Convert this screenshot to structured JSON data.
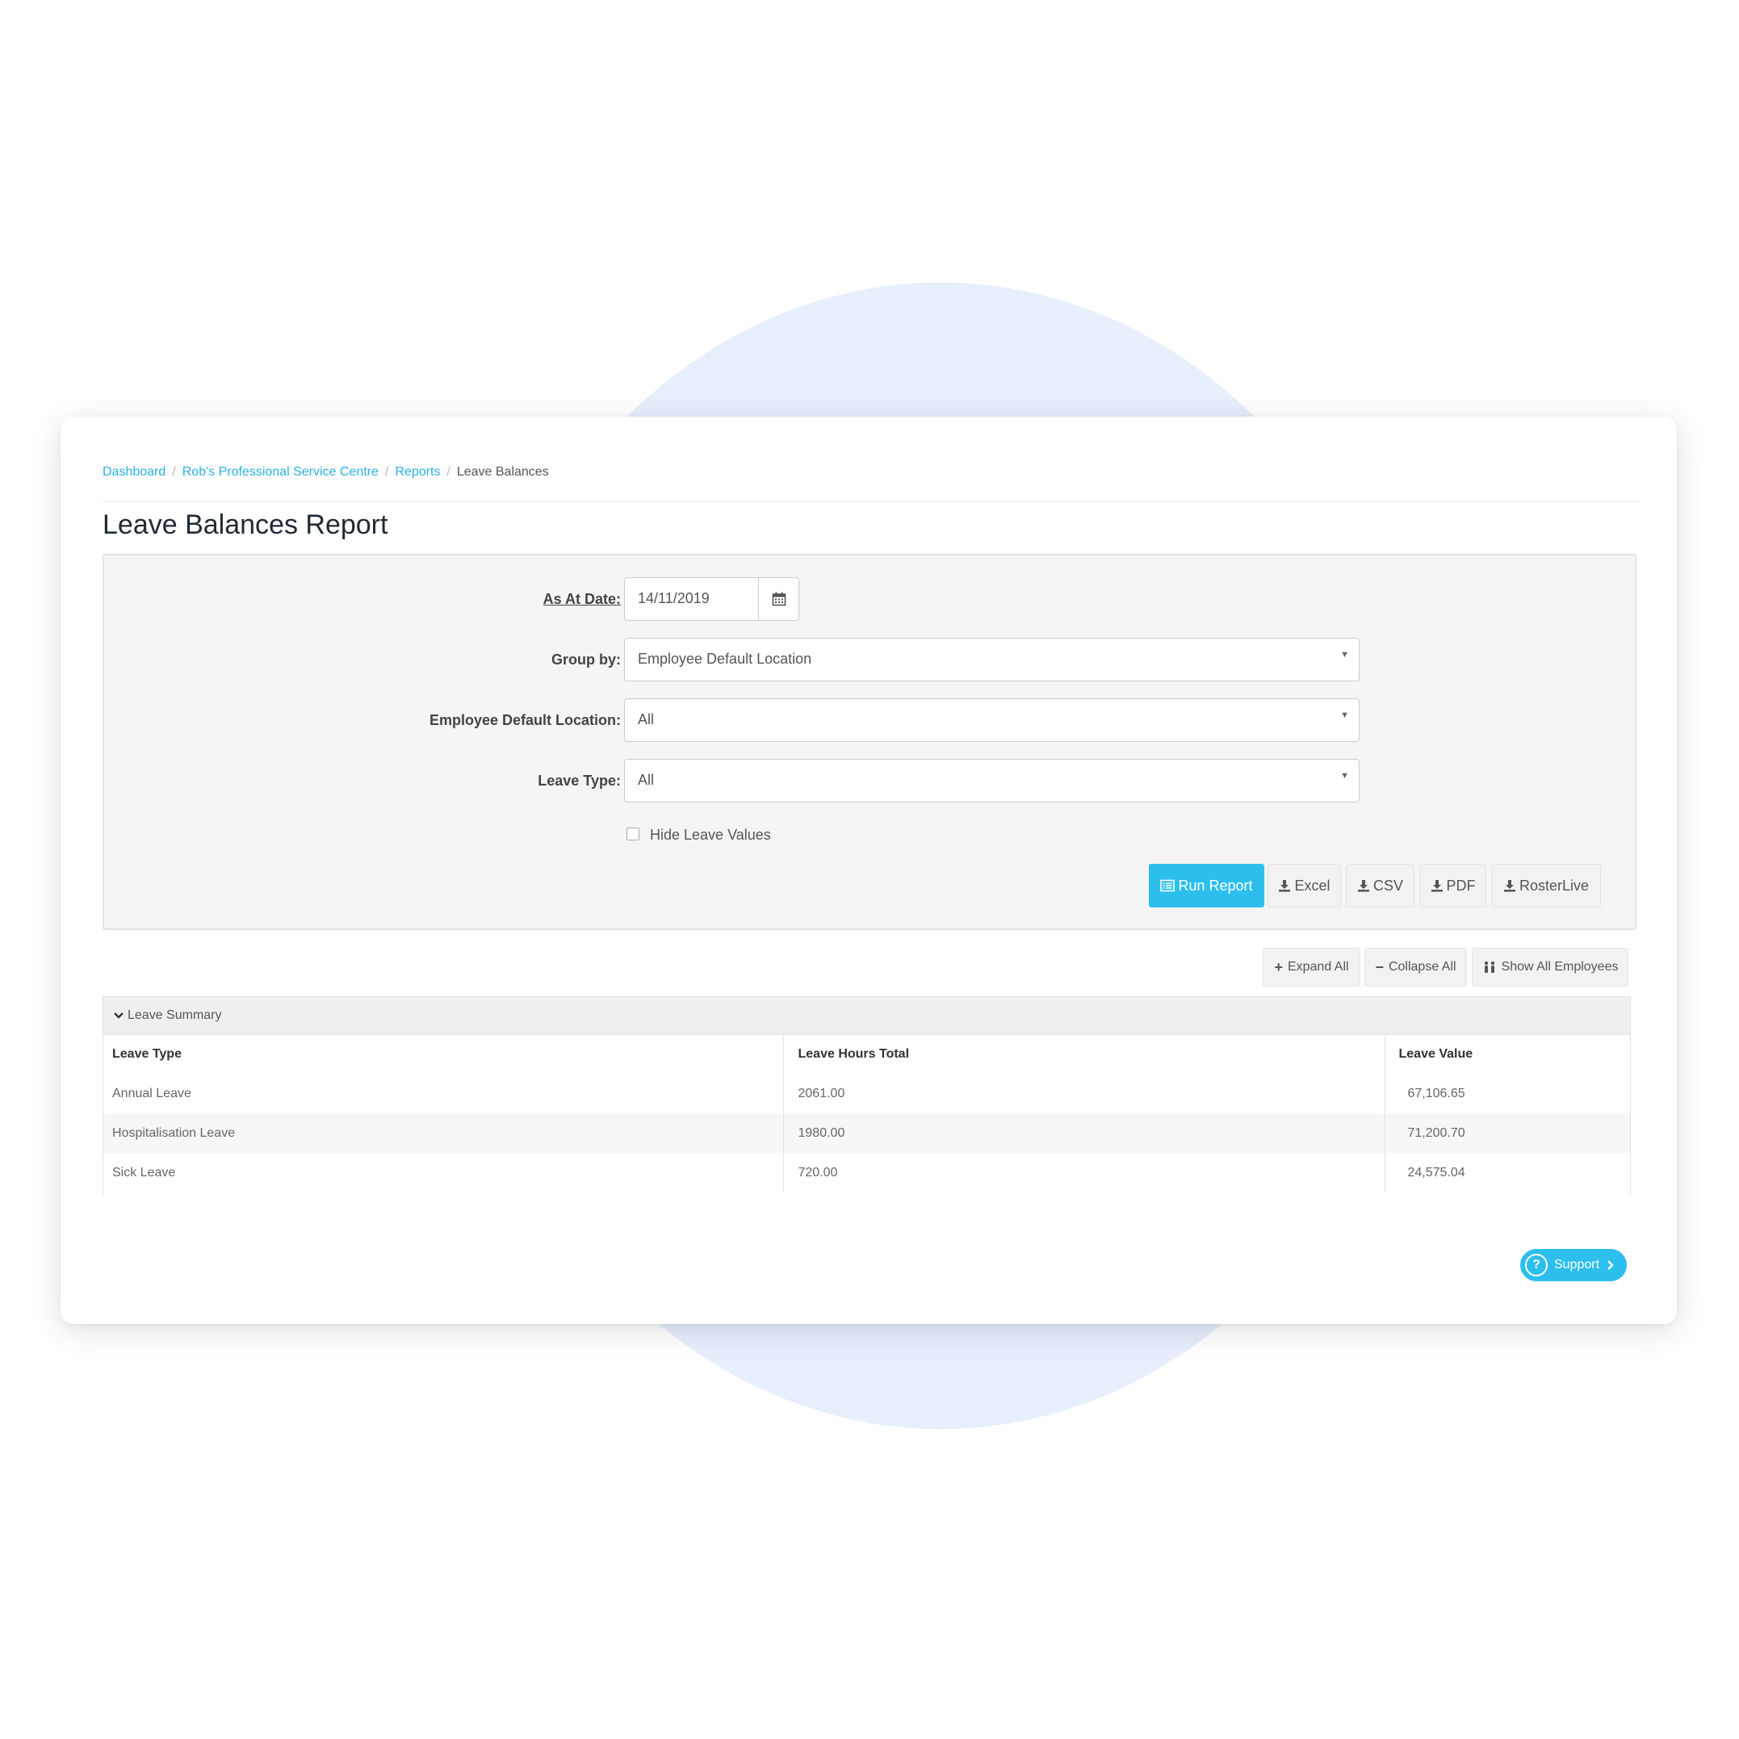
{
  "breadcrumb": {
    "items": [
      "Dashboard",
      "Rob's Professional Service Centre",
      "Reports"
    ],
    "current": "Leave Balances"
  },
  "page": {
    "title": "Leave Balances Report"
  },
  "form": {
    "as_at_date_label": "As At Date:",
    "as_at_date_value": "14/11/2019",
    "group_by_label": "Group by:",
    "group_by_value": "Employee Default Location",
    "location_label": "Employee Default Location:",
    "location_value": "All",
    "leave_type_label": "Leave Type:",
    "leave_type_value": "All",
    "hide_values_label": "Hide Leave Values",
    "hide_values_checked": false
  },
  "actions": {
    "run_report": "Run Report",
    "excel": "Excel",
    "csv": "CSV",
    "pdf": "PDF",
    "rosterlive": "RosterLive"
  },
  "toolbar": {
    "expand_all": "Expand All",
    "collapse_all": "Collapse All",
    "show_all_employees": "Show All Employees"
  },
  "summary": {
    "title": "Leave Summary",
    "columns": [
      "Leave Type",
      "Leave Hours Total",
      "Leave Value"
    ],
    "rows": [
      [
        "Annual Leave",
        "2061.00",
        "67,106.65"
      ],
      [
        "Hospitalisation Leave",
        "1980.00",
        "71,200.70"
      ],
      [
        "Sick Leave",
        "720.00",
        "24,575.04"
      ]
    ]
  },
  "support": {
    "label": "Support"
  },
  "colors": {
    "accent": "#2cbfee",
    "link": "#2cb1e4",
    "panel": "#f5f5f5",
    "backdrop": "#e7eefc"
  }
}
